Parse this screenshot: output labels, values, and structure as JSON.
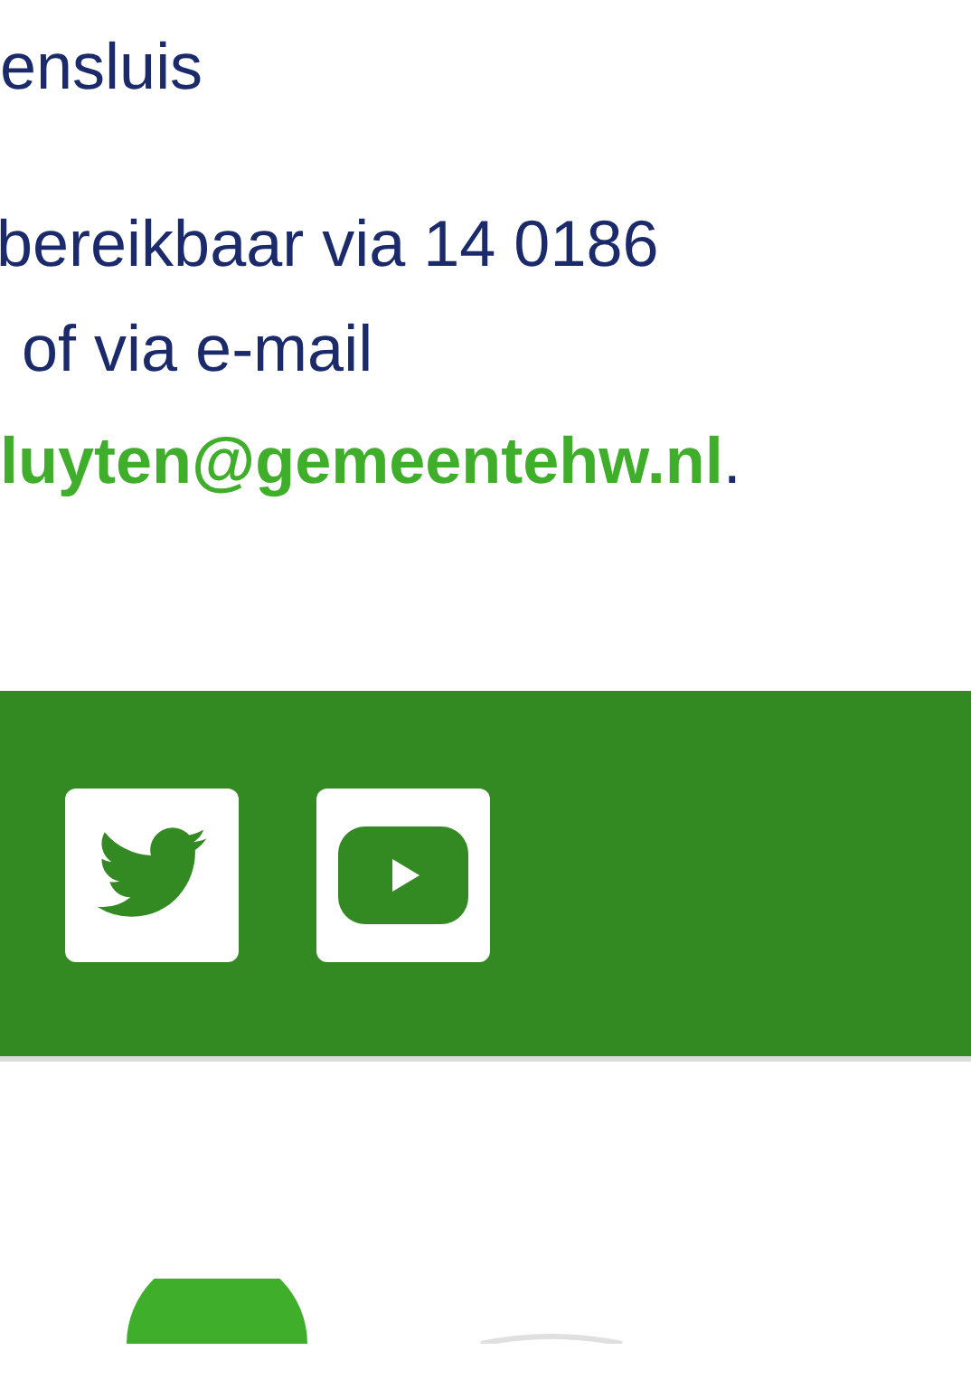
{
  "contact": {
    "heading": "ensluis",
    "line_1": "bereikbaar via 14 0186",
    "line_2": "of via e-mail",
    "email": "luyten@gemeentehw.nl",
    "period": "."
  },
  "footer": {
    "social": [
      {
        "kind": "twitter"
      },
      {
        "kind": "youtube"
      }
    ]
  }
}
